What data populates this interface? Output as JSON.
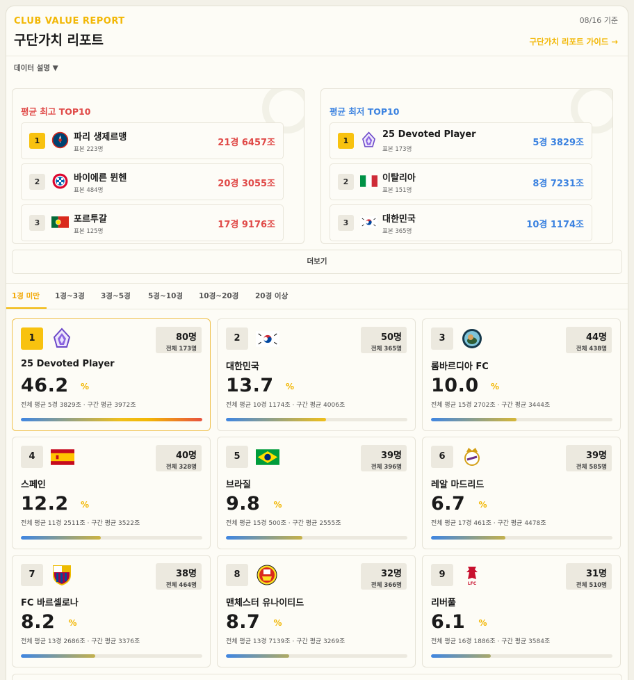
{
  "header": {
    "eyebrow": "CLUB VALUE REPORT",
    "title": "구단가치 리포트",
    "date": "08/16 기준",
    "guide_link": "구단가치 리포트 가이드 →"
  },
  "data_description": "데이터 설명 ▼",
  "top10_high": {
    "title": "평균 최고 TOP10",
    "items": [
      {
        "rank": "1",
        "name": "파리 생제르맹",
        "sample": "표본 223명",
        "value": "21경 6457조",
        "icon": "psg-crest-icon"
      },
      {
        "rank": "2",
        "name": "바이에른 뮌헨",
        "sample": "표본 484명",
        "value": "20경 3055조",
        "icon": "bayern-crest-icon"
      },
      {
        "rank": "3",
        "name": "포르투갈",
        "sample": "표본 125명",
        "value": "17경 9176조",
        "icon": "portugal-flag-icon"
      }
    ]
  },
  "top10_low": {
    "title": "평균 최저 TOP10",
    "items": [
      {
        "rank": "1",
        "name": "25 Devoted Player",
        "sample": "표본 173명",
        "value": "5경 3829조",
        "icon": "devoted-player-icon"
      },
      {
        "rank": "2",
        "name": "이탈리아",
        "sample": "표본 151명",
        "value": "8경 7231조",
        "icon": "italy-flag-icon"
      },
      {
        "rank": "3",
        "name": "대한민국",
        "sample": "표본 365명",
        "value": "10경 1174조",
        "icon": "korea-flag-icon"
      }
    ]
  },
  "more_button": "더보기",
  "tabs": [
    "1경 미만",
    "1경~3경",
    "3경~5경",
    "5경~10경",
    "10경~20경",
    "20경 이상"
  ],
  "active_tab": "1경 미만",
  "cards": [
    {
      "rank": "1",
      "name": "25 Devoted Player",
      "count": "80명",
      "total": "전체 173명",
      "pct": "46.2",
      "pct_sign": "%",
      "sub": "전체 평균 5경 3829조 · 구간 평균 3972조",
      "bar": 1.0,
      "icon": "devoted-player-icon"
    },
    {
      "rank": "2",
      "name": "대한민국",
      "count": "50명",
      "total": "전체 365명",
      "pct": "13.7",
      "pct_sign": "%",
      "sub": "전체 평균 10경 1174조 · 구간 평균 4006조",
      "bar": 0.55,
      "icon": "korea-flag-icon"
    },
    {
      "rank": "3",
      "name": "롬바르디아 FC",
      "count": "44명",
      "total": "전체 438명",
      "pct": "10.0",
      "pct_sign": "%",
      "sub": "전체 평균 15경 2702조 · 구간 평균 3444조",
      "bar": 0.47,
      "icon": "lombardia-crest-icon"
    },
    {
      "rank": "4",
      "name": "스페인",
      "count": "40명",
      "total": "전체 328명",
      "pct": "12.2",
      "pct_sign": "%",
      "sub": "전체 평균 11경 2511조 · 구간 평균 3522조",
      "bar": 0.44,
      "icon": "spain-flag-icon"
    },
    {
      "rank": "5",
      "name": "브라질",
      "count": "39명",
      "total": "전체 396명",
      "pct": "9.8",
      "pct_sign": "%",
      "sub": "전체 평균 15경 500조 · 구간 평균 2555조",
      "bar": 0.42,
      "icon": "brazil-flag-icon"
    },
    {
      "rank": "6",
      "name": "레알 마드리드",
      "count": "39명",
      "total": "전체 585명",
      "pct": "6.7",
      "pct_sign": "%",
      "sub": "전체 평균 17경 461조 · 구간 평균 4478조",
      "bar": 0.41,
      "icon": "real-madrid-crest-icon"
    },
    {
      "rank": "7",
      "name": "FC 바르셀로나",
      "count": "38명",
      "total": "전체 464명",
      "pct": "8.2",
      "pct_sign": "%",
      "sub": "전체 평균 13경 2686조 · 구간 평균 3376조",
      "bar": 0.41,
      "icon": "barcelona-crest-icon"
    },
    {
      "rank": "8",
      "name": "맨체스터 유나이티드",
      "count": "32명",
      "total": "전체 366명",
      "pct": "8.7",
      "pct_sign": "%",
      "sub": "전체 평균 13경 7139조 · 구간 평균 3269조",
      "bar": 0.35,
      "icon": "man-utd-crest-icon"
    },
    {
      "rank": "9",
      "name": "리버풀",
      "count": "31명",
      "total": "전체 510명",
      "pct": "6.1",
      "pct_sign": "%",
      "sub": "전체 평균 16경 1886조 · 구간 평균 3584조",
      "bar": 0.33,
      "icon": "liverpool-crest-icon"
    }
  ],
  "colors": {
    "accent": "#f2b705",
    "high": "#e04a48",
    "low": "#3b82e0"
  }
}
